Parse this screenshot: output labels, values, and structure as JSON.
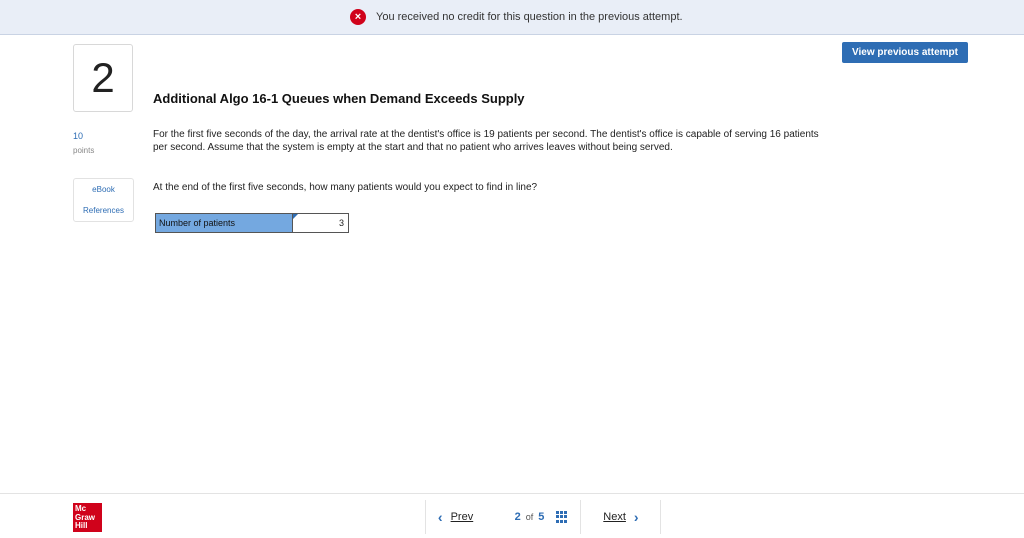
{
  "banner": {
    "icon": "error-icon",
    "message": "You received no credit for this question in the previous attempt."
  },
  "header": {
    "view_previous_label": "View previous attempt"
  },
  "question": {
    "number": "2",
    "points_value": "10",
    "points_label": "points",
    "title": "Additional Algo 16-1 Queues when Demand Exceeds Supply",
    "body": "For the first five seconds of the day, the arrival rate at the dentist's office is 19 patients per second. The dentist's office is capable of serving 16 patients per second. Assume that the system is empty at the start and that no patient who arrives leaves without being served.",
    "prompt": "At the end of the first five seconds, how many patients would you expect to find in line?",
    "answer": {
      "label": "Number of patients",
      "value": "3"
    }
  },
  "resources": {
    "ebook_label": "eBook",
    "references_label": "References"
  },
  "footer": {
    "logo_lines": [
      "Mc",
      "Graw",
      "Hill"
    ],
    "prev_label": "Prev",
    "next_label": "Next",
    "current_page": "2",
    "of_label": "of",
    "total_pages": "5",
    "grid_icon": "grid-icon"
  },
  "colors": {
    "accent": "#2e6db4",
    "error": "#d0021b",
    "answer_label_bg": "#74a8e0"
  }
}
